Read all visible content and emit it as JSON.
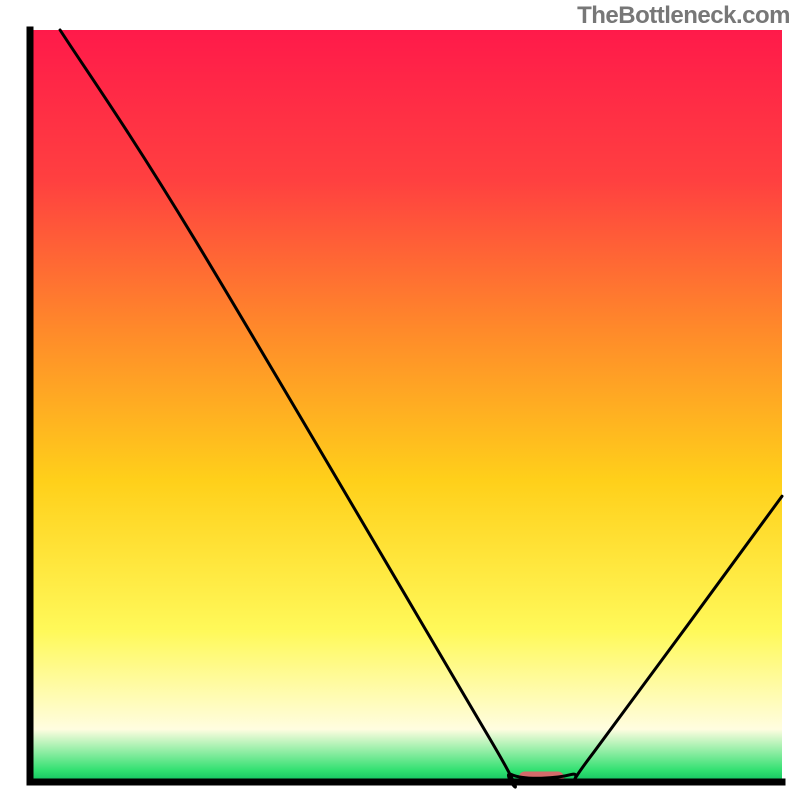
{
  "watermark": "TheBottleneck.com",
  "chart_data": {
    "type": "line",
    "title": "",
    "xlabel": "",
    "ylabel": "",
    "xlim": [
      0,
      100
    ],
    "ylim": [
      0,
      100
    ],
    "background_gradient": {
      "stops": [
        {
          "offset": 0.0,
          "color": "#ff1a4a"
        },
        {
          "offset": 0.2,
          "color": "#ff4040"
        },
        {
          "offset": 0.4,
          "color": "#ff8a2a"
        },
        {
          "offset": 0.6,
          "color": "#ffd01a"
        },
        {
          "offset": 0.8,
          "color": "#fff95a"
        },
        {
          "offset": 0.93,
          "color": "#fffde0"
        },
        {
          "offset": 0.985,
          "color": "#30e070"
        },
        {
          "offset": 1.0,
          "color": "#10c060"
        }
      ]
    },
    "curve": [
      {
        "x": 4,
        "y": 100
      },
      {
        "x": 22,
        "y": 72
      },
      {
        "x": 61,
        "y": 6
      },
      {
        "x": 64,
        "y": 1
      },
      {
        "x": 72,
        "y": 1
      },
      {
        "x": 75,
        "y": 4
      },
      {
        "x": 100,
        "y": 38
      }
    ],
    "marker": {
      "x": 68,
      "y": 0.6,
      "width": 6,
      "height": 1.6,
      "color": "#d46a6a"
    },
    "axes_color": "#000000"
  }
}
